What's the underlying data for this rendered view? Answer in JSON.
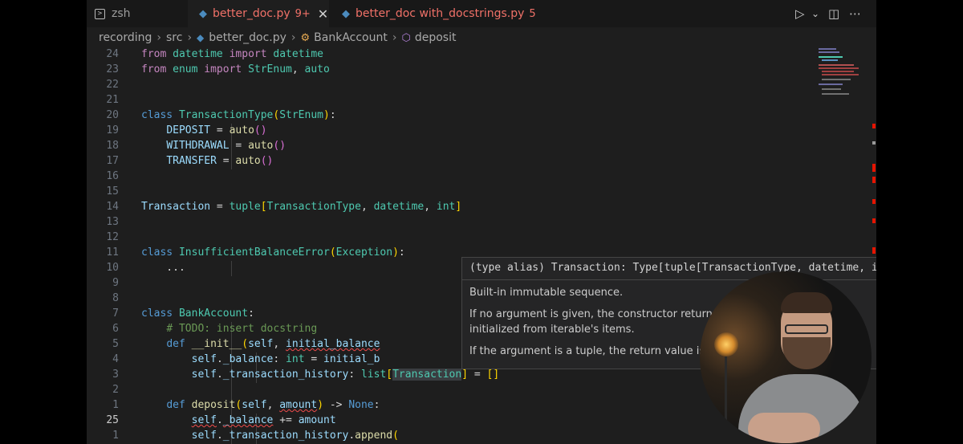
{
  "tabs": [
    {
      "label": "zsh",
      "icon": "terminal-icon",
      "active": false
    },
    {
      "label": "better_doc.py",
      "badge": "9+",
      "icon": "python-file-icon",
      "active": true,
      "close": "✕"
    },
    {
      "label": "better_doc with_docstrings.py",
      "badge": "5",
      "icon": "python-file-icon",
      "active": false
    }
  ],
  "toolbar": {
    "run": "▷",
    "run_menu": "⌄",
    "split": "◫",
    "more": "⋯"
  },
  "breadcrumb": [
    "recording",
    "src",
    "better_doc.py",
    "BankAccount",
    "deposit"
  ],
  "lines": [
    {
      "n": "24",
      "t": [
        [
          "kw",
          "from"
        ],
        [
          "op",
          " "
        ],
        [
          "cl",
          "datetime"
        ],
        [
          "op",
          " "
        ],
        [
          "kw",
          "import"
        ],
        [
          "op",
          " "
        ],
        [
          "cl",
          "datetime"
        ]
      ]
    },
    {
      "n": "23",
      "t": [
        [
          "kw",
          "from"
        ],
        [
          "op",
          " "
        ],
        [
          "cl",
          "enum"
        ],
        [
          "op",
          " "
        ],
        [
          "kw",
          "import"
        ],
        [
          "op",
          " "
        ],
        [
          "cl",
          "StrEnum"
        ],
        [
          "op",
          ", "
        ],
        [
          "cl",
          "auto"
        ]
      ]
    },
    {
      "n": "22",
      "t": []
    },
    {
      "n": "21",
      "t": []
    },
    {
      "n": "20",
      "t": [
        [
          "kb",
          "class"
        ],
        [
          "op",
          " "
        ],
        [
          "cl",
          "TransactionType"
        ],
        [
          "br",
          "("
        ],
        [
          "cl",
          "StrEnum"
        ],
        [
          "br",
          ")"
        ],
        [
          "op",
          ":"
        ]
      ]
    },
    {
      "n": "19",
      "t": [
        [
          "op",
          "    "
        ],
        [
          "pm",
          "DEPOSIT"
        ],
        [
          "op",
          " = "
        ],
        [
          "fn",
          "auto"
        ],
        [
          "br2",
          "()"
        ]
      ]
    },
    {
      "n": "18",
      "t": [
        [
          "op",
          "    "
        ],
        [
          "pm",
          "WITHDRAWAL"
        ],
        [
          "op",
          " = "
        ],
        [
          "fn",
          "auto"
        ],
        [
          "br2",
          "()"
        ]
      ]
    },
    {
      "n": "17",
      "t": [
        [
          "op",
          "    "
        ],
        [
          "pm",
          "TRANSFER"
        ],
        [
          "op",
          " = "
        ],
        [
          "fn",
          "auto"
        ],
        [
          "br2",
          "()"
        ]
      ]
    },
    {
      "n": "16",
      "t": []
    },
    {
      "n": "15",
      "t": []
    },
    {
      "n": "14",
      "t": [
        [
          "pm",
          "Transaction"
        ],
        [
          "op",
          " = "
        ],
        [
          "cl",
          "tuple"
        ],
        [
          "br",
          "["
        ],
        [
          "cl",
          "TransactionType"
        ],
        [
          "op",
          ", "
        ],
        [
          "cl",
          "datetime"
        ],
        [
          "op",
          ", "
        ],
        [
          "cl",
          "int"
        ],
        [
          "br",
          "]"
        ]
      ]
    },
    {
      "n": "13",
      "t": []
    },
    {
      "n": "12",
      "t": []
    },
    {
      "n": "11",
      "t": [
        [
          "kb",
          "class"
        ],
        [
          "op",
          " "
        ],
        [
          "cl",
          "InsufficientBalanceError"
        ],
        [
          "br",
          "("
        ],
        [
          "cl",
          "Exception"
        ],
        [
          "br",
          ")"
        ],
        [
          "op",
          ":"
        ]
      ]
    },
    {
      "n": "10",
      "t": [
        [
          "op",
          "    ..."
        ]
      ]
    },
    {
      "n": "9",
      "t": []
    },
    {
      "n": "8",
      "t": []
    },
    {
      "n": "7",
      "t": [
        [
          "kb",
          "class"
        ],
        [
          "op",
          " "
        ],
        [
          "cl",
          "BankAccount"
        ],
        [
          "op",
          ":"
        ]
      ]
    },
    {
      "n": "6",
      "t": [
        [
          "op",
          "    "
        ],
        [
          "cm",
          "# TODO: insert docstring"
        ]
      ]
    },
    {
      "n": "5",
      "t": [
        [
          "op",
          "    "
        ],
        [
          "kb",
          "def"
        ],
        [
          "op",
          " "
        ],
        [
          "fn",
          "__init__"
        ],
        [
          "br",
          "("
        ],
        [
          "pm",
          "self"
        ],
        [
          "op",
          ", "
        ],
        [
          "pm squig",
          "initial_balance"
        ]
      ]
    },
    {
      "n": "4",
      "t": [
        [
          "op",
          "        "
        ],
        [
          "pm",
          "self"
        ],
        [
          "op",
          "."
        ],
        [
          "pm",
          "_balance"
        ],
        [
          "op",
          ": "
        ],
        [
          "cl",
          "int"
        ],
        [
          "op",
          " = "
        ],
        [
          "pm",
          "initial_b"
        ]
      ]
    },
    {
      "n": "3",
      "t": [
        [
          "op",
          "        "
        ],
        [
          "pm",
          "self"
        ],
        [
          "op",
          "."
        ],
        [
          "pm",
          "_transaction_history"
        ],
        [
          "op",
          ": "
        ],
        [
          "cl",
          "list"
        ],
        [
          "br",
          "["
        ],
        [
          "cl hl",
          "Transaction"
        ],
        [
          "br",
          "]"
        ],
        [
          "op",
          " = "
        ],
        [
          "br",
          "[]"
        ]
      ]
    },
    {
      "n": "2",
      "t": []
    },
    {
      "n": "1",
      "t": [
        [
          "op",
          "    "
        ],
        [
          "kb",
          "def"
        ],
        [
          "op",
          " "
        ],
        [
          "fn",
          "deposit"
        ],
        [
          "br",
          "("
        ],
        [
          "pm",
          "self"
        ],
        [
          "op",
          ", "
        ],
        [
          "pm squig",
          "amount"
        ],
        [
          "br",
          ")"
        ],
        [
          "op",
          " -> "
        ],
        [
          "kb",
          "None"
        ],
        [
          "op",
          ":"
        ]
      ]
    },
    {
      "n": "25",
      "cur": true,
      "t": [
        [
          "op",
          "        "
        ],
        [
          "pm squig",
          "self"
        ],
        [
          "op",
          "."
        ],
        [
          "pm squig",
          "_balance"
        ],
        [
          "op",
          " += "
        ],
        [
          "pm",
          "amount"
        ]
      ]
    },
    {
      "n": "1",
      "t": [
        [
          "op",
          "        "
        ],
        [
          "pm",
          "self"
        ],
        [
          "op",
          "."
        ],
        [
          "pm",
          "_transaction_history"
        ],
        [
          "op",
          "."
        ],
        [
          "fn",
          "append"
        ],
        [
          "br",
          "("
        ]
      ]
    }
  ],
  "hover": {
    "signature": "(type alias) Transaction: Type[tuple[TransactionType, datetime, int]]",
    "p1": "Built-in immutable sequence.",
    "p2a": "If no argument is given, the constructor returns an empty tuple. If ite",
    "p2b": "initialized from iterable's items.",
    "p3": "If the argument is a tuple, the return value is the same object."
  },
  "colors": {
    "editor_bg": "#1e1e1e",
    "error": "#e51400",
    "accent": "#4b8bbe"
  }
}
